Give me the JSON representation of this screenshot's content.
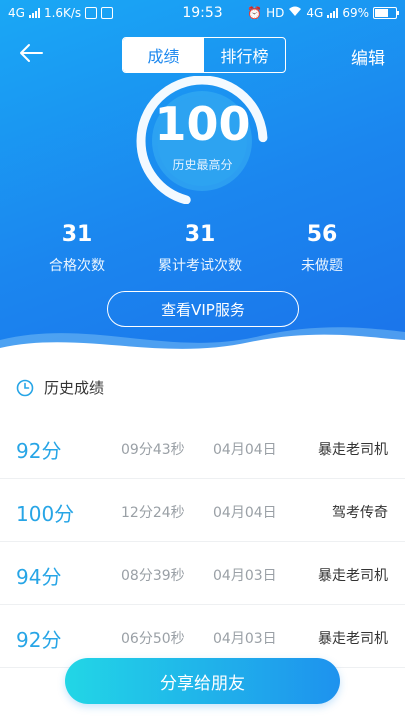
{
  "status_bar": {
    "network_left": "4G",
    "speed": "1.6K/s",
    "time": "19:53",
    "hd": "HD",
    "network_right": "4G",
    "battery": "69%"
  },
  "header": {
    "tabs": [
      {
        "label": "成绩",
        "active": true
      },
      {
        "label": "排行榜",
        "active": false
      }
    ],
    "edit_label": "编辑"
  },
  "summary": {
    "best_score": "100",
    "best_score_label": "历史最高分",
    "stats": [
      {
        "value": "31",
        "label": "合格次数"
      },
      {
        "value": "31",
        "label": "累计考试次数"
      },
      {
        "value": "56",
        "label": "未做题"
      }
    ],
    "vip_button": "查看VIP服务"
  },
  "history": {
    "title": "历史成绩",
    "rows": [
      {
        "score": "92分",
        "duration": "09分43秒",
        "date": "04月04日",
        "title": "暴走老司机"
      },
      {
        "score": "100分",
        "duration": "12分24秒",
        "date": "04月04日",
        "title": "驾考传奇"
      },
      {
        "score": "94分",
        "duration": "08分39秒",
        "date": "04月03日",
        "title": "暴走老司机"
      },
      {
        "score": "92分",
        "duration": "06分50秒",
        "date": "04月03日",
        "title": "暴走老司机"
      }
    ]
  },
  "share_button": "分享给朋友",
  "colors": {
    "hero_blue": "#1b86ef",
    "score_blue": "#27a5e6",
    "share_start": "#22d6e6",
    "share_end": "#1e92ee"
  }
}
